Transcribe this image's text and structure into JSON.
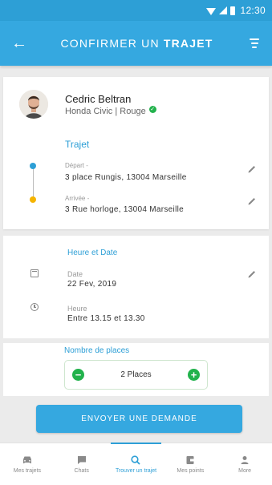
{
  "status_bar": {
    "time": "12:30"
  },
  "header": {
    "title_prefix": "CONFIRMER UN",
    "title_strong": "TRAJET"
  },
  "driver": {
    "name": "Cedric Beltran",
    "car": "Honda Civic | Rouge"
  },
  "trip": {
    "title": "Trajet",
    "departure_label": "Départ -",
    "departure_value": "3 place Rungis, 13004 Marseille",
    "arrival_label": "Arrivée -",
    "arrival_value": "3 Rue horloge, 13004 Marseille"
  },
  "schedule": {
    "title": "Heure et Date",
    "date_label": "Date",
    "date_value": "22 Fev, 2019",
    "time_label": "Heure",
    "time_value": "Entre 13.15 et 13.30"
  },
  "places": {
    "title": "Nombre de places",
    "value": "2 Places"
  },
  "submit": {
    "label": "ENVOYER UNE DEMANDE"
  },
  "nav": {
    "items": [
      {
        "label": "Mes trajets",
        "icon": "car-icon"
      },
      {
        "label": "Chats",
        "icon": "chat-icon"
      },
      {
        "label": "Trouver un trajet",
        "icon": "search-icon"
      },
      {
        "label": "Mes points",
        "icon": "wallet-icon"
      },
      {
        "label": "More",
        "icon": "person-icon"
      }
    ]
  },
  "colors": {
    "primary": "#35a8e0",
    "success": "#22b24c",
    "destination": "#f5b400"
  }
}
